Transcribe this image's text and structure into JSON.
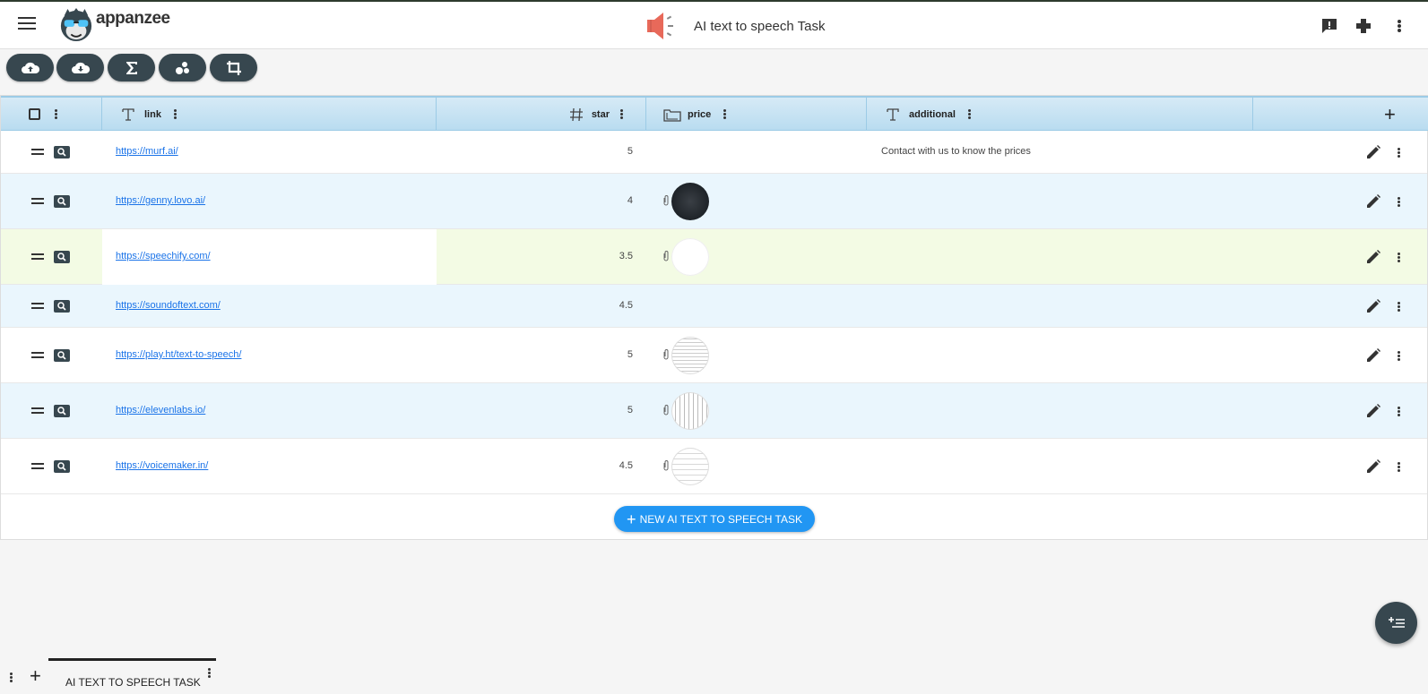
{
  "app": {
    "brand": "appanzee",
    "page_title": "AI text to speech Task"
  },
  "columns": {
    "link": "link",
    "star": "star",
    "price": "price",
    "additional": "additional"
  },
  "rows": [
    {
      "link": "https://murf.ai/",
      "star": "5",
      "price": "",
      "additional": "Contact with us to know the prices"
    },
    {
      "link": "https://genny.lovo.ai/",
      "star": "4",
      "price": "attachment",
      "additional": ""
    },
    {
      "link": "https://speechify.com/",
      "star": "3.5",
      "price": "attachment",
      "additional": ""
    },
    {
      "link": "https://soundoftext.com/",
      "star": "4.5",
      "price": "",
      "additional": ""
    },
    {
      "link": "https://play.ht/text-to-speech/",
      "star": "5",
      "price": "attachment",
      "additional": ""
    },
    {
      "link": "https://elevenlabs.io/",
      "star": "5",
      "price": "attachment",
      "additional": ""
    },
    {
      "link": "https://voicemaker.in/",
      "star": "4.5",
      "price": "attachment",
      "additional": ""
    }
  ],
  "new_button": "NEW AI TEXT TO SPEECH TASK",
  "tab": {
    "label": "AI TEXT TO SPEECH TASK"
  },
  "colors": {
    "accent": "#2196f3",
    "dark": "#37474f",
    "header_blue": "#b9dcf0",
    "row_alt": "#eaf6fd",
    "row_highlight": "#f3fbe4"
  }
}
